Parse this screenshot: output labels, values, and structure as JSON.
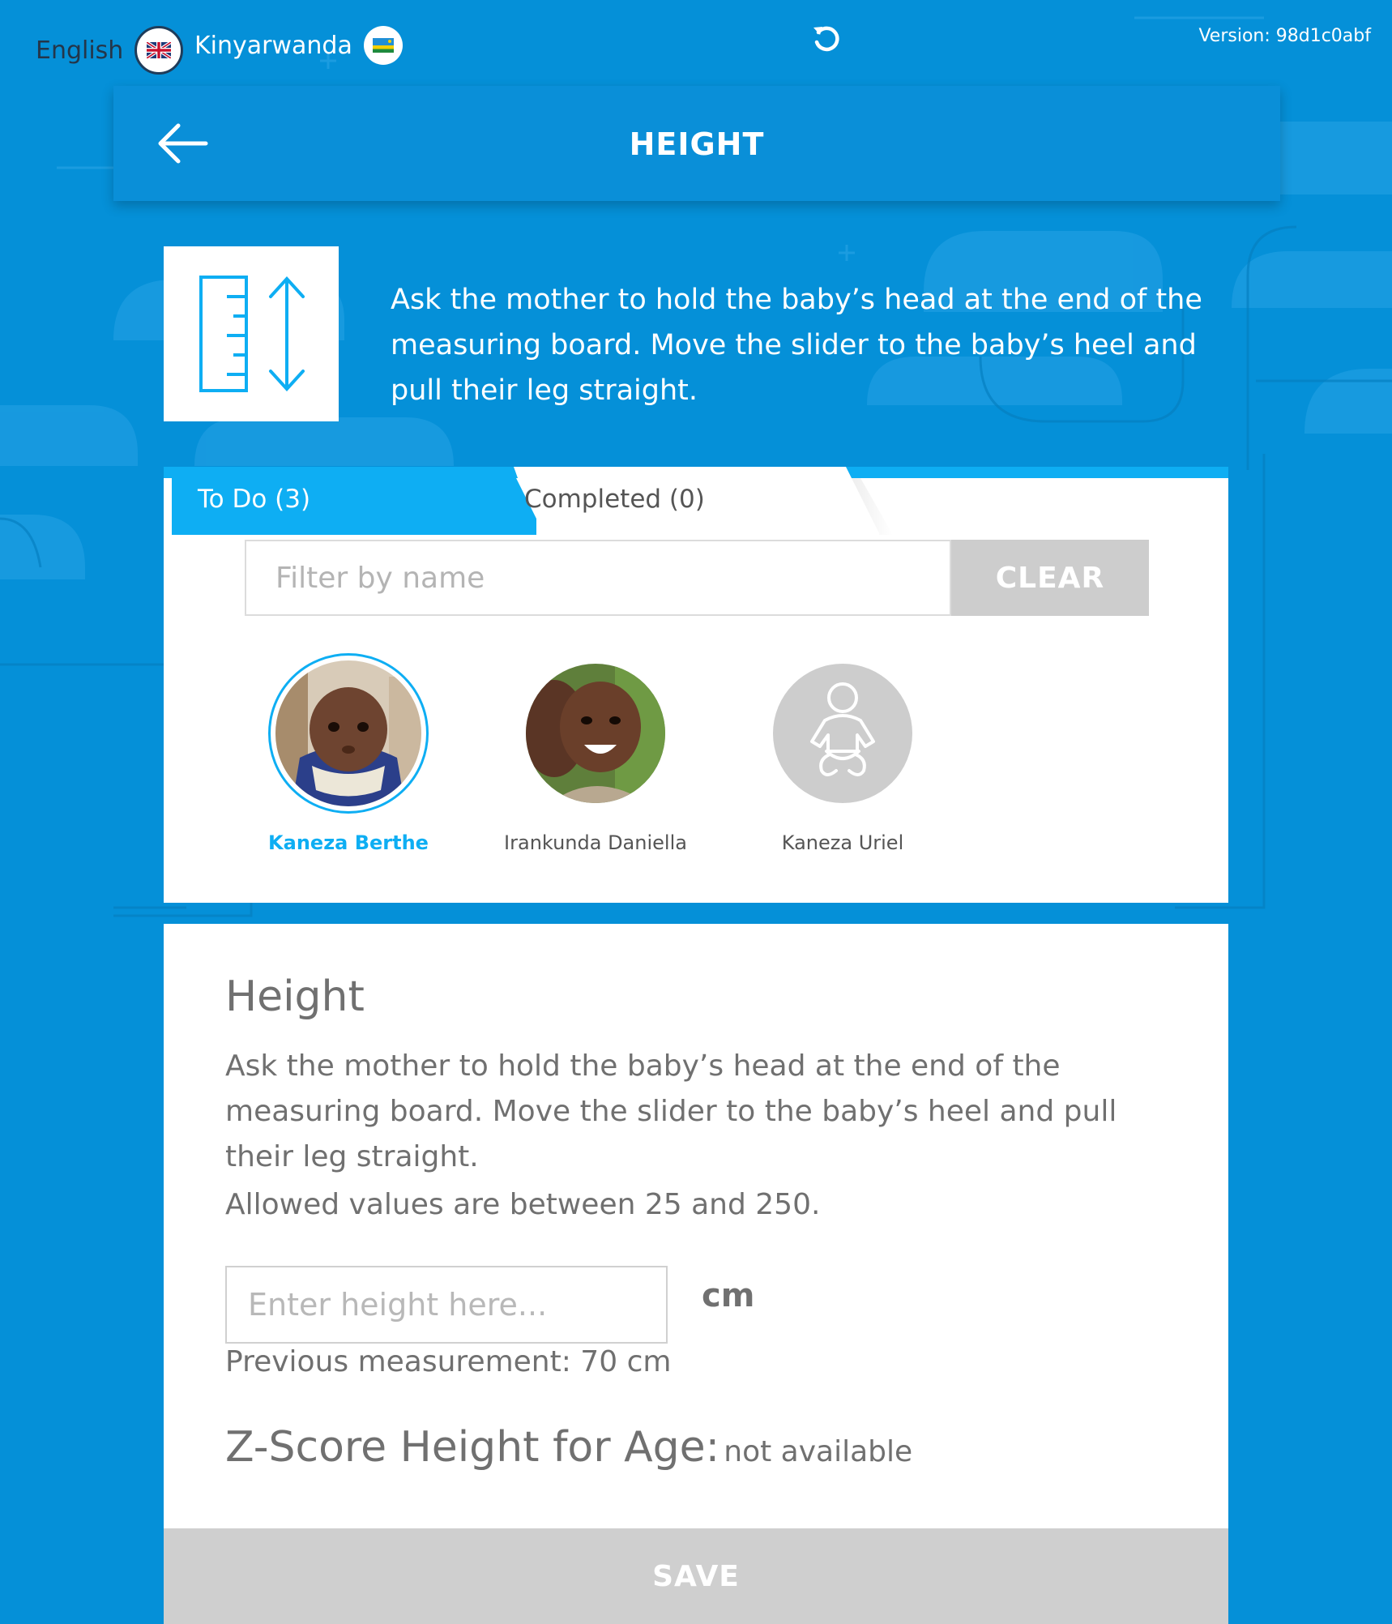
{
  "topbar": {
    "languages": [
      {
        "label": "English",
        "flag_icon": "uk-flag-icon",
        "active": true
      },
      {
        "label": "Kinyarwanda",
        "flag_icon": "rwanda-flag-icon",
        "active": false
      }
    ],
    "refresh_icon": "refresh-icon",
    "version": "Version: 98d1c0abf"
  },
  "header": {
    "back_icon": "back-arrow-icon",
    "title": "HEIGHT"
  },
  "instruction": {
    "icon": "measuring-board-icon",
    "text": "Ask the mother to hold the baby’s head at the end of the measuring board. Move the slider to the baby’s heel and pull their leg straight."
  },
  "tabs": [
    {
      "label": "To Do (3)",
      "active": true
    },
    {
      "label": "Completed (0)",
      "active": false
    }
  ],
  "filter": {
    "placeholder": "Filter by name",
    "value": "",
    "clear_label": "CLEAR"
  },
  "patients": [
    {
      "name": "Kaneza Berthe",
      "selected": true,
      "avatar": "photo"
    },
    {
      "name": "Irankunda Daniella",
      "selected": false,
      "avatar": "photo"
    },
    {
      "name": "Kaneza Uriel",
      "selected": false,
      "avatar": "baby-placeholder-icon"
    }
  ],
  "form": {
    "title": "Height",
    "instruction": "Ask the mother to hold the baby’s head at the end of the measuring board. Move the slider to the baby’s heel and pull their leg straight.",
    "allowed": "Allowed values are between 25 and 250.",
    "input_placeholder": "Enter height here...",
    "input_value": "",
    "unit": "cm",
    "previous": "Previous measurement: 70 cm",
    "zscore_label": "Z-Score Height for Age:",
    "zscore_value": "not available",
    "save_label": "SAVE"
  },
  "colors": {
    "background": "#0590d8",
    "accent": "#0eaef3",
    "disabled": "#cdcdcd",
    "text_gray": "#707070"
  }
}
